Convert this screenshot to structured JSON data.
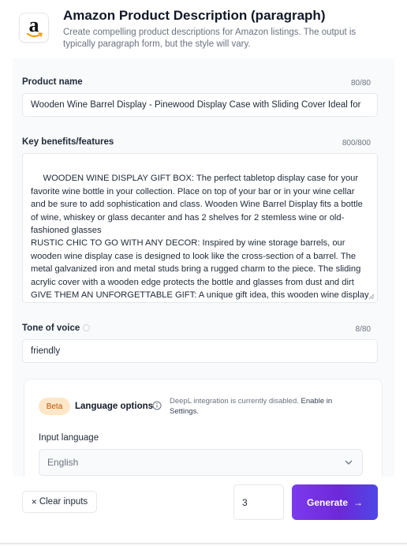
{
  "header": {
    "title": "Amazon Product Description (paragraph)",
    "description": "Create compelling product descriptions for Amazon listings. The output is typically paragraph form, but the style will vary.",
    "logo_letter": "a"
  },
  "product_name": {
    "label": "Product name",
    "counter": "80/80",
    "value": "Wooden Wine Barrel Display - Pinewood Display Case with Sliding Cover Ideal for"
  },
  "features": {
    "label": "Key benefits/features",
    "counter": "800/800",
    "value": " WOODEN WINE DISPLAY GIFT BOX: The perfect tabletop display case for your favorite wine bottle in your collection. Place on top of your bar or in your wine cellar and be sure to add sophistication and class. Wooden Wine Barrel Display fits a bottle of wine, whiskey or glass decanter and has 2 shelves for 2 stemless wine or old-fashioned glasses\nRUSTIC CHIC TO GO WITH ANY DECOR: Inspired by wine storage barrels, our wooden wine display case is designed to look like the cross-section of a barrel. The metal galvanized iron and metal studs bring a rugged charm to the piece. The sliding acrylic cover with a wooden edge protects the bottle and glasses from dust and dirt\nGIVE THEM AN UNFORGETTABLE GIFT: A unique gift idea, this wooden wine display box is the perfect gift that will be sure to and"
  },
  "tone": {
    "label": "Tone of voice",
    "counter": "8/80",
    "value": "friendly"
  },
  "language_options": {
    "badge": "Beta",
    "title": "Language options",
    "note_prefix": "DeepL integration is currently disabled.",
    "note_suffix": "Enable in Settings.",
    "input_language_label": "Input language",
    "input_language_value": "English"
  },
  "footer": {
    "clear_label": "Clear inputs",
    "clear_icon": "×",
    "outputs_count": "3",
    "generate_label": "Generate",
    "generate_arrow": "→"
  },
  "colors": {
    "accent_start": "#7c3aed",
    "accent_end": "#4f46e5",
    "beta_bg": "#fde7c8",
    "beta_text": "#b45309"
  }
}
